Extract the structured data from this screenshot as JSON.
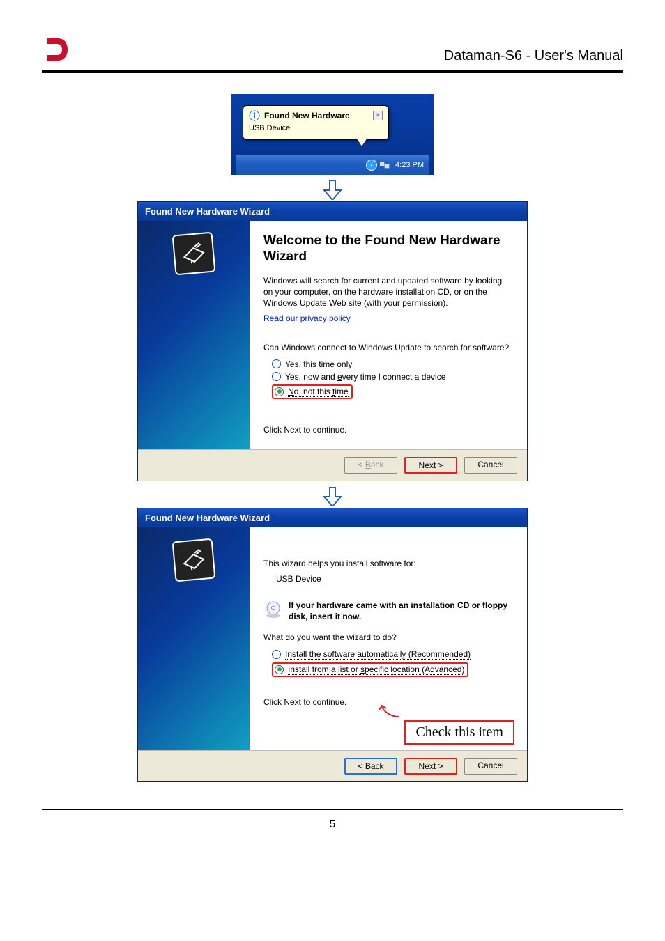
{
  "header": {
    "doc_title": "Dataman-S6 - User's Manual"
  },
  "tray": {
    "balloon_title": "Found New Hardware",
    "balloon_sub": "USB Device",
    "time": "4:23 PM"
  },
  "wizard1": {
    "title": "Found New Hardware Wizard",
    "heading": "Welcome to the Found New Hardware Wizard",
    "para1": "Windows will search for current and updated software by looking on your computer, on the hardware installation CD, or on the Windows Update Web site (with your permission).",
    "privacy_link": "Read our privacy policy",
    "question": "Can Windows connect to Windows Update to search for software?",
    "opt1": "Yes, this time only",
    "opt2": "Yes, now and every time I connect a device",
    "opt3": "No, not this time",
    "continue": "Click Next to continue.",
    "btn_back": "< Back",
    "btn_next": "Next >",
    "btn_cancel": "Cancel"
  },
  "wizard2": {
    "title": "Found New Hardware Wizard",
    "intro": "This wizard helps you install software for:",
    "device": "USB Device",
    "cd_text": "If your hardware came with an installation CD or floppy disk, insert it now.",
    "question": "What do you want the wizard to do?",
    "opt1": "Install the software automatically (Recommended)",
    "opt2": "Install from a list or specific location (Advanced)",
    "continue": "Click Next to continue.",
    "annotation": "Check this item",
    "btn_back": "< Back",
    "btn_next": "Next >",
    "btn_cancel": "Cancel"
  },
  "footer": {
    "page_number": "5"
  }
}
